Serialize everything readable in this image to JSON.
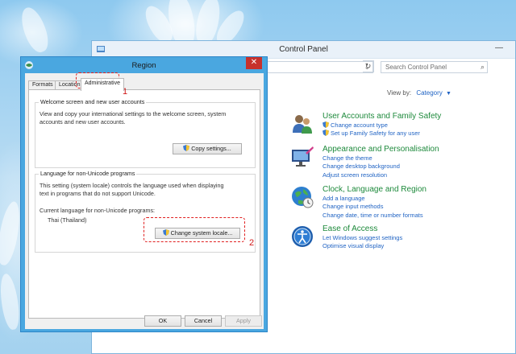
{
  "control_panel": {
    "title": "Control Panel",
    "search_placeholder": "Search Control Panel",
    "view_by_label": "View by:",
    "view_by_value": "Category",
    "sections": [
      {
        "heading": "User Accounts and Family Safety",
        "icon": "users-icon",
        "links": [
          "Change account type",
          "Set up Family Safety for any user"
        ]
      },
      {
        "heading": "Appearance and Personalisation",
        "icon": "appearance-icon",
        "links": [
          "Change the theme",
          "Change desktop background",
          "Adjust screen resolution"
        ]
      },
      {
        "heading": "Clock, Language and Region",
        "icon": "globe-clock-icon",
        "links": [
          "Add a language",
          "Change input methods",
          "Change date, time or number formats"
        ]
      },
      {
        "heading": "Ease of Access",
        "icon": "ease-of-access-icon",
        "links": [
          "Let Windows suggest settings",
          "Optimise visual display"
        ]
      }
    ]
  },
  "region_dialog": {
    "title": "Region",
    "close_glyph": "✕",
    "tabs": [
      "Formats",
      "Location",
      "Administrative"
    ],
    "welcome_group": {
      "legend": "Welcome screen and new user accounts",
      "line1": "View and copy your international settings to the welcome screen, system",
      "line2": "accounts and new user accounts.",
      "button": "Copy settings..."
    },
    "unicode_group": {
      "legend": "Language for non-Unicode programs",
      "line1": "This setting (system locale) controls the language used when displaying",
      "line2": "text in programs that do not support Unicode.",
      "current_label": "Current language for non-Unicode programs:",
      "current_value": "Thai (Thailand)",
      "button": "Change system locale..."
    },
    "footer": {
      "ok": "OK",
      "cancel": "Cancel",
      "apply": "Apply"
    },
    "callouts": [
      "1",
      "2"
    ]
  },
  "colors": {
    "accent_link": "#2164c4",
    "heading_green": "#1e8a3c",
    "dialog_frame": "#4aa7e0",
    "close_red": "#c7312c",
    "callout_red": "#e02020"
  }
}
